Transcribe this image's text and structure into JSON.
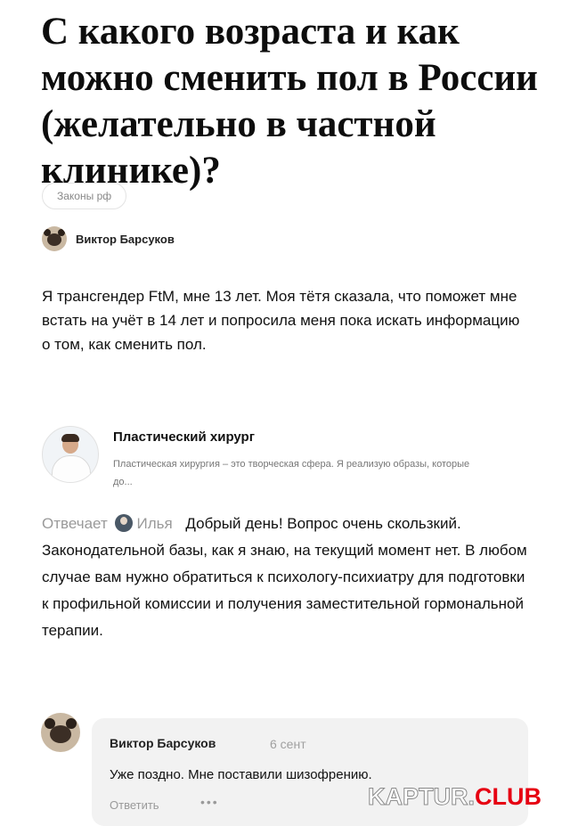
{
  "article": {
    "title": "С какого возраста и как можно сменить пол в России (желательно в частной клинике)?",
    "tag": "Законы рф",
    "author": "Виктор Барсуков",
    "question": "Я трансгендер FtM, мне 13 лет. Моя тётя сказала, что поможет мне встать на учёт в 14 лет и попросила меня пока искать информацию о том, как сменить пол."
  },
  "expert_card": {
    "title": "Пластический хирург",
    "description": "Пластическая хирургия – это творческая сфера. Я реализую образы, которые до..."
  },
  "answer": {
    "prefix": "Отвечает",
    "name": "Илья",
    "text": "Добрый день! Вопрос очень скользкий. Законодательной базы, как я знаю, на текущий момент нет. В любом случае вам нужно обратиться к психологу-психиатру для подготовки к профильной комиссии и получения заместительной гормональной терапии."
  },
  "comment": {
    "author": "Виктор Барсуков",
    "date": "6 сент",
    "text": "Уже поздно. Мне поставили шизофрению.",
    "reply_label": "Ответить",
    "more": "•••"
  },
  "watermark": {
    "part_a": "KAPTUR.",
    "part_b": "CLUB"
  }
}
